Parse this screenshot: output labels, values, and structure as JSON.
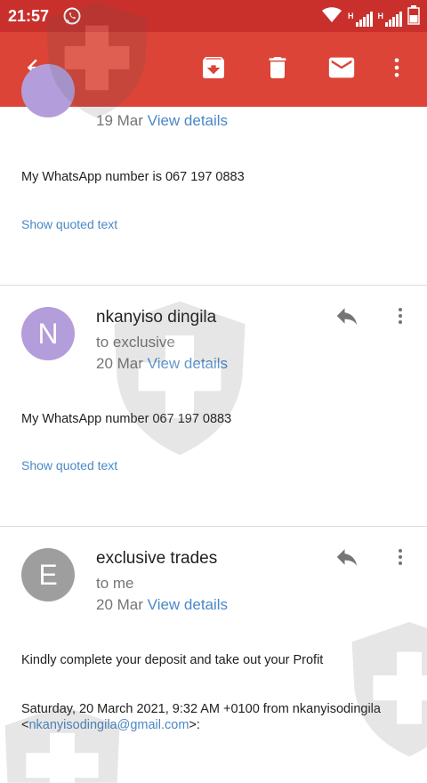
{
  "status_bar": {
    "time": "21:57",
    "network_label_1": "H",
    "network_label_2": "H"
  },
  "toolbar": {
    "icons": [
      "back-arrow-icon",
      "archive-icon",
      "delete-icon",
      "mark-unread-icon",
      "more-vert-icon"
    ]
  },
  "messages": [
    {
      "date": "19 Mar",
      "view_details": "View details",
      "body": "My WhatsApp number is 067 197 0883",
      "show_quoted": "Show quoted text"
    },
    {
      "avatar_letter": "N",
      "avatar_color": "#b39ddb",
      "sender": "nkanyiso dingila",
      "recipient": "to exclusive",
      "date": "20 Mar",
      "view_details": "View details",
      "body": "My WhatsApp number 067 197 0883",
      "show_quoted": "Show quoted text"
    },
    {
      "avatar_letter": "E",
      "avatar_color": "#9e9e9e",
      "sender": "exclusive trades",
      "recipient": "to me",
      "date": "20 Mar",
      "view_details": "View details",
      "body": "Kindly complete your deposit and take out your Profit",
      "quote_header": "Saturday, 20 March 2021, 9:32 AM +0100 from nkanyisodingila",
      "quote_open": "<",
      "quote_email": "nkanyisodingila@gmail.com",
      "quote_close": ">:"
    }
  ],
  "colors": {
    "toolbar": "#db4437",
    "status_bar": "#c9302c",
    "link": "#4a88c7"
  }
}
